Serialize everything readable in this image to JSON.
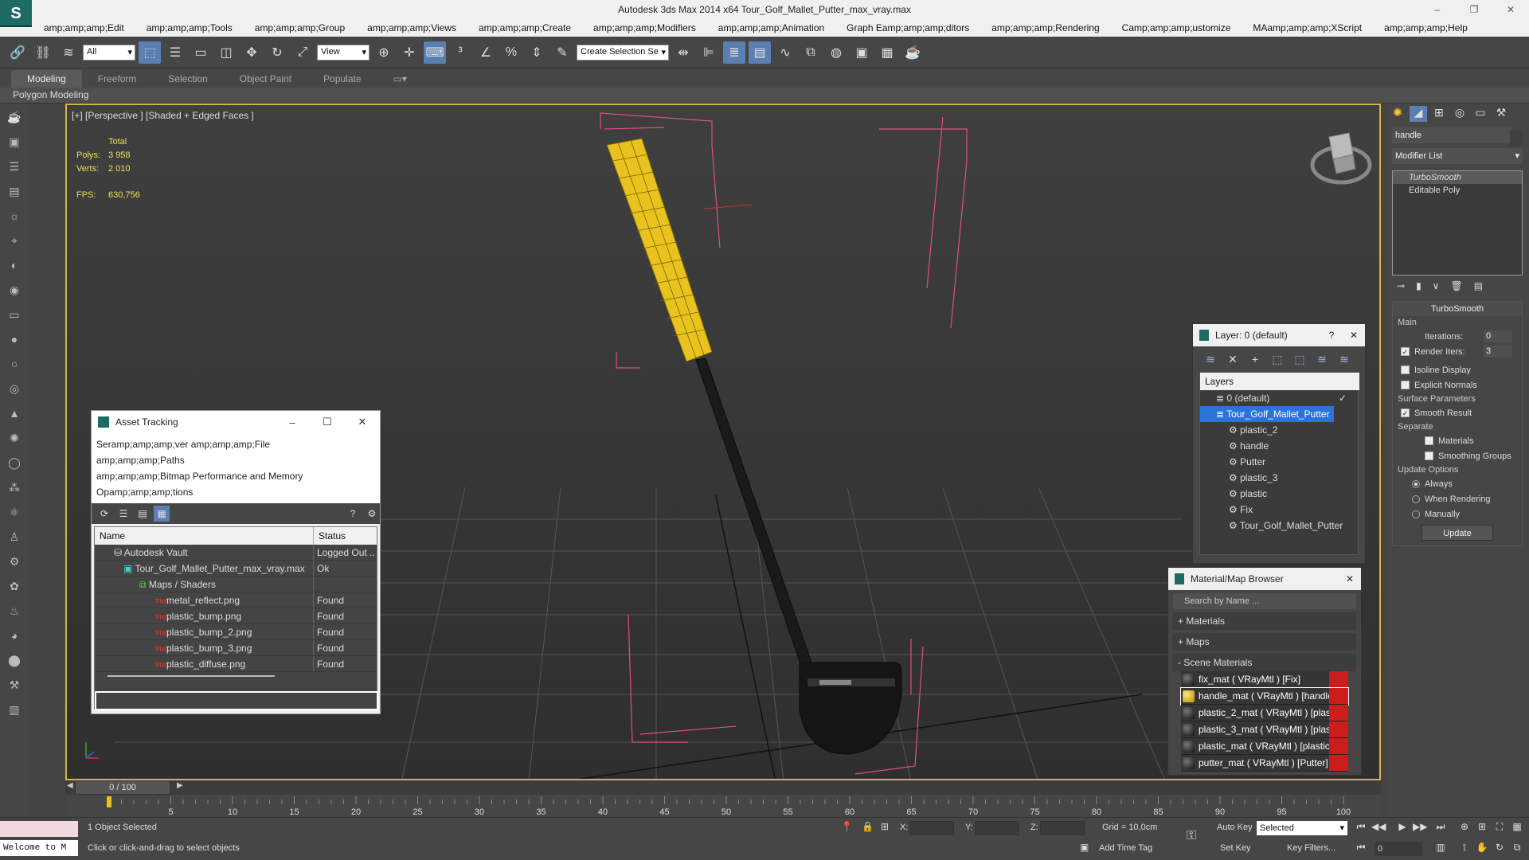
{
  "window": {
    "title": "Autodesk 3ds Max  2014 x64     Tour_Golf_Mallet_Putter_max_vray.max",
    "logo_text": "S",
    "minimize": "–",
    "restore": "❐",
    "close": "✕"
  },
  "menu": [
    "amp;amp;amp;Edit",
    "amp;amp;amp;Tools",
    "amp;amp;amp;Group",
    "amp;amp;amp;Views",
    "amp;amp;amp;Create",
    "amp;amp;amp;Modifiers",
    "amp;amp;amp;Animation",
    "Graph Eamp;amp;amp;ditors",
    "amp;amp;amp;Rendering",
    "Camp;amp;amp;ustomize",
    "MAamp;amp;amp;XScript",
    "amp;amp;amp;Help"
  ],
  "toolbar": {
    "filter_select": "All",
    "refcoord_select": "View",
    "named_selection": "Create Selection Se"
  },
  "ribbon": {
    "tabs": [
      "Modeling",
      "Freeform",
      "Selection",
      "Object Paint",
      "Populate"
    ],
    "active_tab": "Modeling",
    "sub_label": "Polygon Modeling"
  },
  "viewport": {
    "label": "[+] [Perspective ] [Shaded + Edged Faces ]",
    "stats": {
      "total_label": "Total",
      "polys_label": "Polys:",
      "polys_value": "3 958",
      "verts_label": "Verts:",
      "verts_value": "2 010",
      "fps_label": "FPS:",
      "fps_value": "630,756"
    }
  },
  "asset_tracking": {
    "title": "Asset Tracking",
    "menu_lines": [
      "Seramp;amp;amp;ver     amp;amp;amp;File",
      "amp;amp;amp;Paths",
      "amp;amp;amp;Bitmap Performance and Memory",
      "Opamp;amp;amp;tions"
    ],
    "columns": [
      "Name",
      "Status"
    ],
    "rows": [
      {
        "name": "Autodesk Vault",
        "status": "Logged Out ..",
        "indent": 1
      },
      {
        "name": "Tour_Golf_Mallet_Putter_max_vray.max",
        "status": "Ok",
        "indent": 2
      },
      {
        "name": "Maps / Shaders",
        "status": "",
        "indent": 3
      },
      {
        "name": "metal_reflect.png",
        "status": "Found",
        "indent": 4
      },
      {
        "name": "plastic_bump.png",
        "status": "Found",
        "indent": 4
      },
      {
        "name": "plastic_bump_2.png",
        "status": "Found",
        "indent": 4
      },
      {
        "name": "plastic_bump_3.png",
        "status": "Found",
        "indent": 4
      },
      {
        "name": "plastic_diffuse.png",
        "status": "Found",
        "indent": 4
      }
    ],
    "png_badge": "PNG"
  },
  "layer_manager": {
    "title": "Layer: 0 (default)",
    "help": "?",
    "column": "Layers",
    "items": [
      {
        "name": "0 (default)",
        "level": 1
      },
      {
        "name": "Tour_Golf_Mallet_Putter",
        "level": 1
      },
      {
        "name": "plastic_2",
        "level": 2
      },
      {
        "name": "handle",
        "level": 2
      },
      {
        "name": "Putter",
        "level": 2
      },
      {
        "name": "plastic_3",
        "level": 2
      },
      {
        "name": "plastic",
        "level": 2
      },
      {
        "name": "Fix",
        "level": 2
      },
      {
        "name": "Tour_Golf_Mallet_Putter",
        "level": 2
      }
    ]
  },
  "material_browser": {
    "title": "Material/Map Browser",
    "search_placeholder": "Search by Name ...",
    "sections": [
      "+ Materials",
      "+ Maps",
      "- Scene Materials"
    ],
    "materials": [
      {
        "name": "fix_mat  ( VRayMtl )  [Fix]",
        "swatch": "dark"
      },
      {
        "name": "handle_mat  ( VRayMtl )  [handle]",
        "swatch": "yellow"
      },
      {
        "name": "plastic_2_mat  ( VRayMtl )  [plastic...",
        "swatch": "dark"
      },
      {
        "name": "plastic_3_mat  ( VRayMtl )  [plastic...",
        "swatch": "dark"
      },
      {
        "name": "plastic_mat  ( VRayMtl )  [plastic]",
        "swatch": "dark"
      },
      {
        "name": "putter_mat  ( VRayMtl )  [Putter]",
        "swatch": "dark"
      }
    ],
    "flag_color": "#cc1d1d"
  },
  "command_panel": {
    "object_name": "handle",
    "modifier_list": "Modifier List",
    "stack": [
      "TurboSmooth",
      "Editable Poly"
    ],
    "turbosmooth": {
      "title": "TurboSmooth",
      "main": "Main",
      "iterations_label": "Iterations:",
      "iterations": "0",
      "render_iters_label": "Render Iters:",
      "render_iters": "3",
      "isoline": "Isoline Display",
      "explicit": "Explicit Normals",
      "surface": "Surface Parameters",
      "smooth_result": "Smooth Result",
      "separate": "Separate",
      "materials": "Materials",
      "smoothing_groups": "Smoothing Groups",
      "update_options": "Update Options",
      "always": "Always",
      "when_rendering": "When Rendering",
      "manually": "Manually",
      "update_btn": "Update"
    }
  },
  "timeline": {
    "frame": "0 / 100",
    "ticks": [
      "5",
      "10",
      "15",
      "20",
      "25",
      "30",
      "35",
      "40",
      "45",
      "50",
      "55",
      "60",
      "65",
      "70",
      "75",
      "80",
      "85",
      "90",
      "95",
      "100"
    ]
  },
  "status": {
    "welcome": "Welcome to M",
    "selected": "1 Object Selected",
    "hint": "Click or click-and-drag to select objects",
    "x": "X:",
    "y": "Y:",
    "z": "Z:",
    "grid": "Grid = 10,0cm",
    "add_time_tag": "Add Time Tag",
    "auto_key": "Auto Key",
    "set_key": "Set Key",
    "selected_dropdown": "Selected",
    "key_filters": "Key Filters...",
    "frame_field": "0"
  },
  "colors": {
    "accent": "#5b7fb0",
    "viewport_border": "#d6b24a",
    "handle_yellow": "#e8c21e",
    "bbox_pink": "#e0507a"
  }
}
